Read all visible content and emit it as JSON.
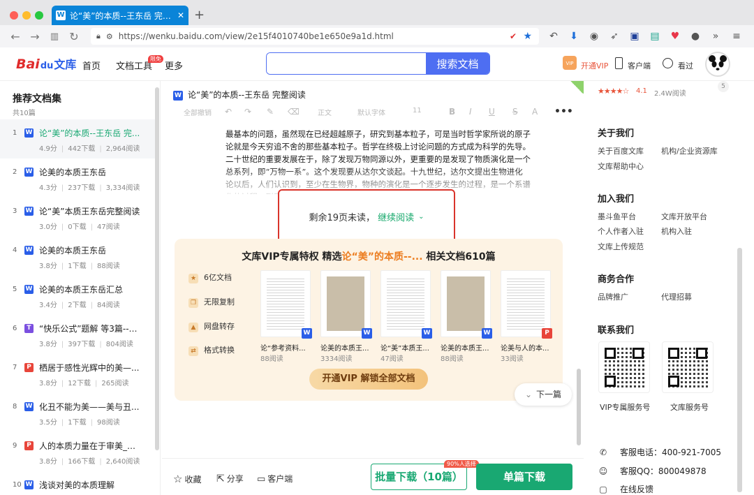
{
  "browser": {
    "tab_title": "论“美”的本质--王东岳 完整阅读 - ",
    "url": "https://wenku.baidu.com/view/2e15f4010740be1e650e9a1d.html"
  },
  "header": {
    "logo_main": "Bai",
    "logo_suffix": "文库",
    "nav": [
      "首页",
      "文档工具",
      "更多"
    ],
    "new_badge": "限免",
    "search_button": "搜索文档",
    "vip_label": "开通VIP",
    "client_label": "客户端",
    "history_label": "看过"
  },
  "sidebar": {
    "title": "推荐文档集",
    "count": "共10篇",
    "items": [
      {
        "num": "1",
        "title": "论“美”的本质--王东岳 完...",
        "score": "4.9分",
        "downloads": "442下载",
        "reads": "2,964阅读",
        "type": "W",
        "color": "#2a5ee8"
      },
      {
        "num": "2",
        "title": "论美的本质王东岳",
        "score": "4.3分",
        "downloads": "237下载",
        "reads": "3,334阅读",
        "type": "W",
        "color": "#2a5ee8"
      },
      {
        "num": "3",
        "title": "论“美”本质王东岳完整阅读",
        "score": "3.0分",
        "downloads": "0下载",
        "reads": "47阅读",
        "type": "W",
        "color": "#2a5ee8"
      },
      {
        "num": "4",
        "title": "论美的本质王东岳",
        "score": "3.8分",
        "downloads": "1下载",
        "reads": "88阅读",
        "type": "W",
        "color": "#2a5ee8"
      },
      {
        "num": "5",
        "title": "论美的本质王东岳汇总",
        "score": "3.4分",
        "downloads": "2下载",
        "reads": "84阅读",
        "type": "W",
        "color": "#2a5ee8"
      },
      {
        "num": "6",
        "title": "“快乐公式”题解 等3篇--王...",
        "score": "3.8分",
        "downloads": "397下载",
        "reads": "804阅读",
        "type": "T",
        "color": "#7b4fe0"
      },
      {
        "num": "7",
        "title": "栖居于感性光辉中的美—...",
        "score": "3.8分",
        "downloads": "12下载",
        "reads": "265阅读",
        "type": "P",
        "color": "#e8453a"
      },
      {
        "num": "8",
        "title": "化丑不能为美——美与丑...",
        "score": "3.5分",
        "downloads": "1下载",
        "reads": "98阅读",
        "type": "W",
        "color": "#2a5ee8"
      },
      {
        "num": "9",
        "title": "人的本质力量在于审美_重...",
        "score": "3.8分",
        "downloads": "166下载",
        "reads": "2,640阅读",
        "type": "P",
        "color": "#e8453a"
      },
      {
        "num": "10",
        "title": "浅谈对美的本质理解",
        "score": "",
        "downloads": "",
        "reads": "",
        "type": "W",
        "color": "#2a5ee8"
      }
    ]
  },
  "doc": {
    "title": "论“美”的本质--王东岳 完整阅读",
    "toolbar": [
      "全部撤销",
      "正文",
      "默认字体",
      "11"
    ],
    "body": "最基本的问题，虽然现在已经超越原子，研究到基本粒子，可是当时哲学家所说的原子论就是今天穷追不舍的那些基本粒子。哲学在终极上讨论问题的方式成为科学的先导。二十世纪的重要发展在于，除了发现万物同源以外，更重要的是发现了物质演化是一个总系列，即“万物一系”。这个发现要从达尔文谈起。十九世纪，达尔文提出生物进化论以后，人们认识到，至少在生物界，物种的演化是一个逐步发生的过程，是一个系谱化的过程。到了二十世纪，这个结论被大大地扩展了……",
    "remain_text": "剩余19页未读，",
    "continue_text": "继续阅读",
    "next_label": "下一篇"
  },
  "vip_panel": {
    "title_prefix": "文库VIP专属特权 精选",
    "title_highlight": "论“美”的本质--...",
    "title_suffix": " 相关文档610篇",
    "features": [
      "6亿文档",
      "无限复制",
      "网盘转存",
      "格式转换"
    ],
    "docs": [
      {
        "title": "论“参考资料...",
        "reads": "88阅读",
        "type": "W",
        "color": "#2a5ee8"
      },
      {
        "title": "论美的本质王...",
        "reads": "3334阅读",
        "type": "W",
        "color": "#2a5ee8"
      },
      {
        "title": "论“美”本质王...",
        "reads": "47阅读",
        "type": "W",
        "color": "#2a5ee8"
      },
      {
        "title": "论美的本质王...",
        "reads": "88阅读",
        "type": "W",
        "color": "#2a5ee8"
      },
      {
        "title": "论美与人的本...",
        "reads": "33阅读",
        "type": "P",
        "color": "#e8453a"
      }
    ],
    "cta": "开通VIP 解锁全部文档"
  },
  "bottom": {
    "collect": "收藏",
    "share": "分享",
    "client": "客户端",
    "bulk": "批量下载（10篇）",
    "bulk_badge": "90%人选择",
    "single": "单篇下载"
  },
  "right": {
    "rating": "4.1",
    "reads": "2.4W阅读",
    "corner_num": "5",
    "about_title": "关于我们",
    "about_links": [
      "关于百度文库",
      "机构/企业资源库",
      "文库帮助中心"
    ],
    "join_title": "加入我们",
    "join_links": [
      "墨斗鱼平台",
      "文库开放平台",
      "个人作者入驻",
      "机构入驻",
      "文库上传规范"
    ],
    "biz_title": "商务合作",
    "biz_links": [
      "品牌推广",
      "代理招募"
    ],
    "contact_title": "联系我们",
    "qr_labels": [
      "VIP专属服务号",
      "文库服务号"
    ],
    "phone": "客服电话：400-921-7005",
    "qq": "客服QQ：800049878",
    "feedback": "在线反馈"
  }
}
